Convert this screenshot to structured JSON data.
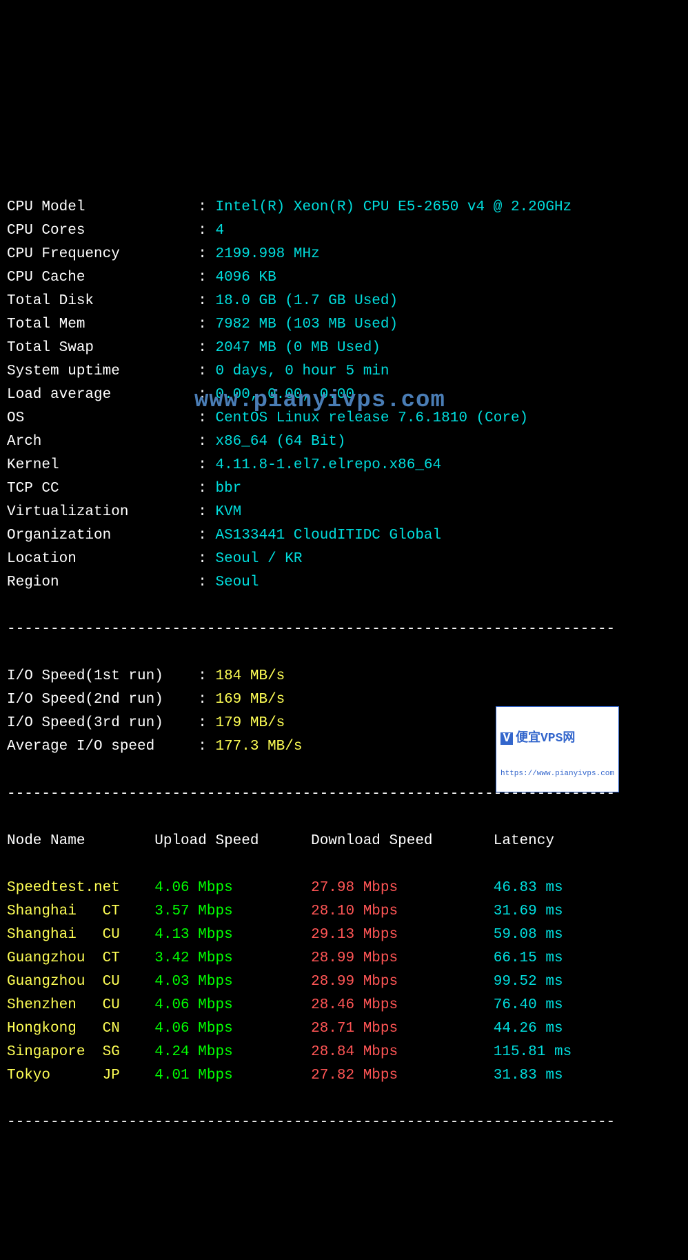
{
  "sysinfo": [
    {
      "label": "CPU Model           ",
      "value": "Intel(R) Xeon(R) CPU E5-2650 v4 @ 2.20GHz"
    },
    {
      "label": "CPU Cores           ",
      "value": "4"
    },
    {
      "label": "CPU Frequency       ",
      "value": "2199.998 MHz"
    },
    {
      "label": "CPU Cache           ",
      "value": "4096 KB"
    },
    {
      "label": "Total Disk          ",
      "value": "18.0 GB (1.7 GB Used)"
    },
    {
      "label": "Total Mem           ",
      "value": "7982 MB (103 MB Used)"
    },
    {
      "label": "Total Swap          ",
      "value": "2047 MB (0 MB Used)"
    },
    {
      "label": "System uptime       ",
      "value": "0 days, 0 hour 5 min"
    },
    {
      "label": "Load average        ",
      "value": "0.00, 0.00, 0.00"
    },
    {
      "label": "OS                  ",
      "value": "CentOS Linux release 7.6.1810 (Core)"
    },
    {
      "label": "Arch                ",
      "value": "x86_64 (64 Bit)"
    },
    {
      "label": "Kernel              ",
      "value": "4.11.8-1.el7.elrepo.x86_64"
    },
    {
      "label": "TCP CC              ",
      "value": "bbr"
    },
    {
      "label": "Virtualization      ",
      "value": "KVM"
    },
    {
      "label": "Organization        ",
      "value": "AS133441 CloudITIDC Global"
    },
    {
      "label": "Location            ",
      "value": "Seoul / KR"
    },
    {
      "label": "Region              ",
      "value": "Seoul"
    }
  ],
  "iospeed": [
    {
      "label": "I/O Speed(1st run)  ",
      "value": "184 MB/s"
    },
    {
      "label": "I/O Speed(2nd run)  ",
      "value": "169 MB/s"
    },
    {
      "label": "I/O Speed(3rd run)  ",
      "value": "179 MB/s"
    },
    {
      "label": "Average I/O speed   ",
      "value": "177.3 MB/s"
    }
  ],
  "divider": "----------------------------------------------------------------------",
  "watermark": "www.pianyivps.com",
  "speedtest_header": {
    "node": "Node Name        ",
    "upload": "Upload Speed      ",
    "download": "Download Speed       ",
    "latency": "Latency"
  },
  "speedtest": [
    {
      "node": "Speedtest.net    ",
      "upload": "4.06 Mbps         ",
      "download": "27.98 Mbps           ",
      "latency": "46.83 ms"
    },
    {
      "node": "Shanghai   CT    ",
      "upload": "3.57 Mbps         ",
      "download": "28.10 Mbps           ",
      "latency": "31.69 ms"
    },
    {
      "node": "Shanghai   CU    ",
      "upload": "4.13 Mbps         ",
      "download": "29.13 Mbps           ",
      "latency": "59.08 ms"
    },
    {
      "node": "Guangzhou  CT    ",
      "upload": "3.42 Mbps         ",
      "download": "28.99 Mbps           ",
      "latency": "66.15 ms"
    },
    {
      "node": "Guangzhou  CU    ",
      "upload": "4.03 Mbps         ",
      "download": "28.99 Mbps           ",
      "latency": "99.52 ms"
    },
    {
      "node": "Shenzhen   CU    ",
      "upload": "4.06 Mbps         ",
      "download": "28.46 Mbps           ",
      "latency": "76.40 ms"
    },
    {
      "node": "Hongkong   CN    ",
      "upload": "4.06 Mbps         ",
      "download": "28.71 Mbps           ",
      "latency": "44.26 ms"
    },
    {
      "node": "Singapore  SG    ",
      "upload": "4.24 Mbps         ",
      "download": "28.84 Mbps           ",
      "latency": "115.81 ms"
    },
    {
      "node": "Tokyo      JP    ",
      "upload": "4.01 Mbps         ",
      "download": "27.82 Mbps           ",
      "latency": "31.83 ms"
    }
  ],
  "badge": {
    "icon": "V",
    "text": "便宜VPS网",
    "url": "https://www.pianyivps.com"
  }
}
